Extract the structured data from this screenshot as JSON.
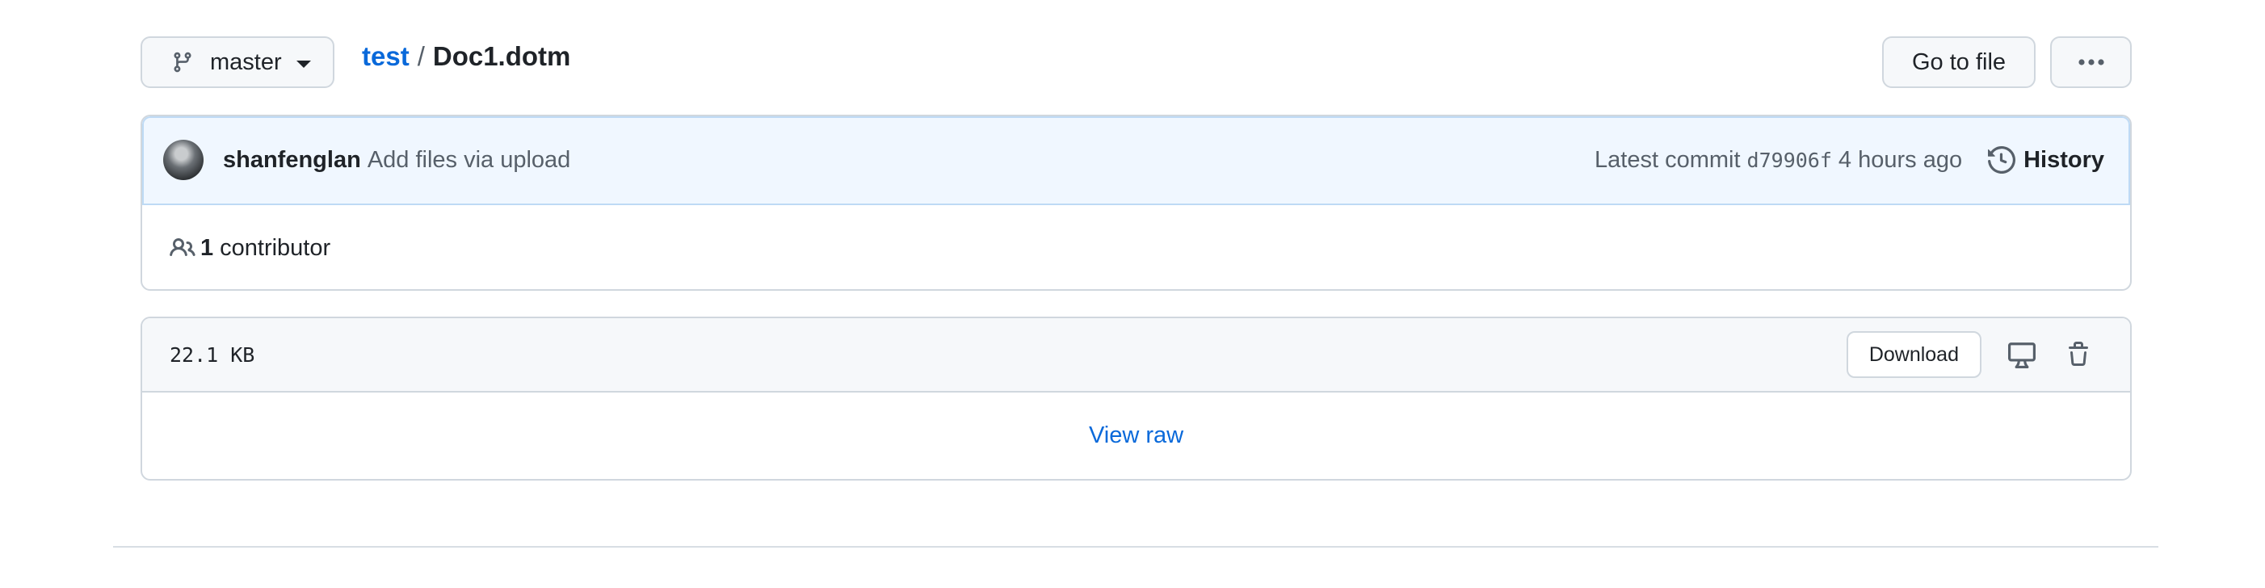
{
  "branch": {
    "name": "master"
  },
  "breadcrumb": {
    "repo": "test",
    "separator": "/",
    "file": "Doc1.dotm"
  },
  "toolbar": {
    "go_to_file": "Go to file",
    "more_icon": "kebab-horizontal-icon"
  },
  "commit": {
    "author": "shanfenglan",
    "message": "Add files via upload",
    "latest_label": "Latest commit",
    "sha": "d79906f",
    "time": "4 hours ago",
    "history_label": "History"
  },
  "contributors": {
    "count": "1",
    "label": "contributor"
  },
  "file": {
    "size": "22.1 KB",
    "download_label": "Download",
    "view_raw_label": "View raw"
  },
  "colors": {
    "link": "#0969da",
    "border": "#d0d7de",
    "commit_bg": "#f0f7ff",
    "header_bg": "#f6f8fa"
  }
}
